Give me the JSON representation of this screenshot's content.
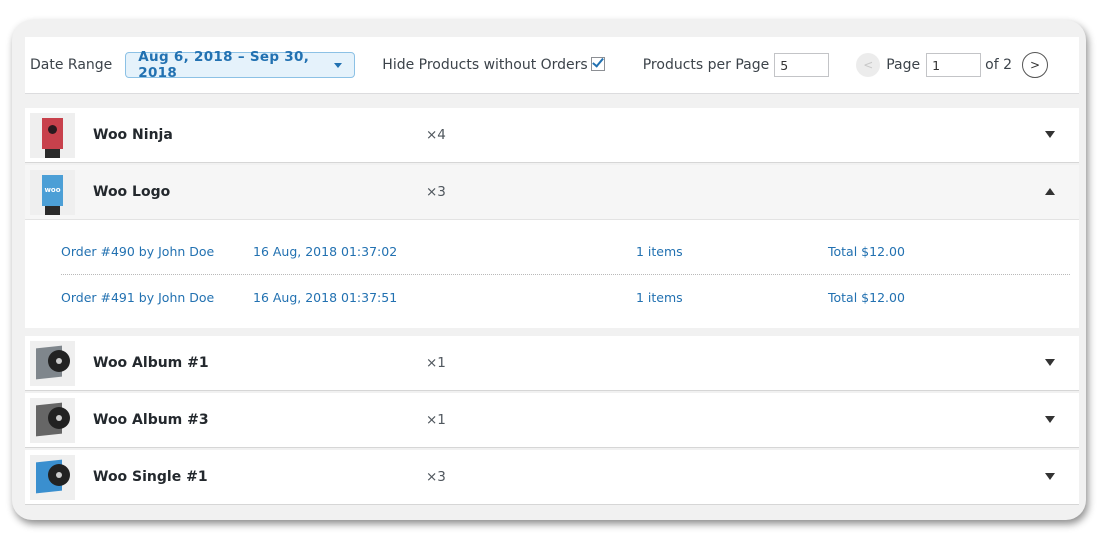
{
  "toolbar": {
    "date_range_label": "Date Range",
    "date_range_value": "Aug 6, 2018 – Sep 30, 2018",
    "hide_products_label": "Hide Products without Orders",
    "hide_products_checked": true,
    "products_per_page_label": "Products per Page",
    "products_per_page_value": "5",
    "prev_symbol": "<",
    "page_label": "Page",
    "page_value": "1",
    "of_label": "of 2",
    "next_symbol": ">"
  },
  "products": [
    {
      "name": "Woo Ninja",
      "qty": "×4",
      "expanded": false,
      "icon": "ninja-poster-icon"
    },
    {
      "name": "Woo Logo",
      "qty": "×3",
      "expanded": true,
      "icon": "woo-logo-poster-icon"
    },
    {
      "name": "Woo Album #1",
      "qty": "×1",
      "expanded": false,
      "icon": "album-icon"
    },
    {
      "name": "Woo Album #3",
      "qty": "×1",
      "expanded": false,
      "icon": "album-icon"
    },
    {
      "name": "Woo Single #1",
      "qty": "×3",
      "expanded": false,
      "icon": "single-icon"
    }
  ],
  "thumb_text": {
    "woo": "woo"
  },
  "orders": [
    {
      "order": "Order #490 by John Doe",
      "date": "16 Aug, 2018 01:37:02",
      "items": "1 items",
      "total": "Total $12.00"
    },
    {
      "order": "Order #491 by John Doe",
      "date": "16 Aug, 2018 01:37:51",
      "items": "1 items",
      "total": "Total $12.00"
    }
  ],
  "colors": {
    "accent": "#2271b1",
    "date_bg": "#e5f2fb",
    "card_bg": "#f1f1f1"
  }
}
